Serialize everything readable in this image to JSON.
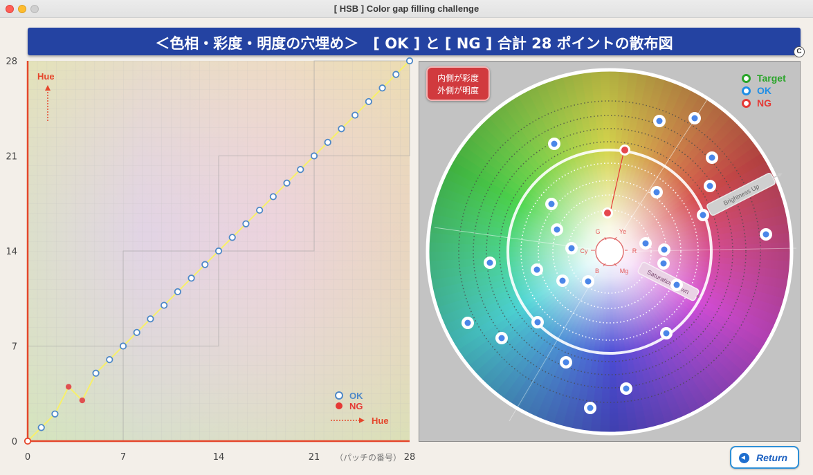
{
  "window": {
    "title": "[ HSB ] Color gap filling challenge"
  },
  "banner": {
    "title": "＜色相・彩度・明度の穴埋め＞　[ OK ] と [ NG ]  合計 28 ポイントの散布図",
    "badge": "C"
  },
  "chart_data": {
    "type": "line",
    "x": [
      0,
      1,
      2,
      3,
      4,
      5,
      6,
      7,
      8,
      9,
      10,
      11,
      12,
      13,
      14,
      15,
      16,
      17,
      18,
      19,
      20,
      21,
      22,
      23,
      24,
      25,
      26,
      27,
      28
    ],
    "series": [
      {
        "name": "OK",
        "status": [
          "ok",
          "ok",
          "ok",
          "ng",
          "ng",
          "ok",
          "ok",
          "ok",
          "ok",
          "ok",
          "ok",
          "ok",
          "ok",
          "ok",
          "ok",
          "ok",
          "ok",
          "ok",
          "ok",
          "ok",
          "ok",
          "ok",
          "ok",
          "ok",
          "ok",
          "ok",
          "ok",
          "ok",
          "ok"
        ],
        "values": [
          0,
          1,
          2,
          4,
          3,
          5,
          6,
          7,
          8,
          9,
          10,
          11,
          12,
          13,
          14,
          15,
          16,
          17,
          18,
          19,
          20,
          21,
          22,
          23,
          24,
          25,
          26,
          27,
          28
        ]
      }
    ],
    "xticks": [
      0,
      7,
      14,
      21,
      28
    ],
    "yticks": [
      0,
      7,
      14,
      21,
      28
    ],
    "xlim": [
      0,
      28
    ],
    "ylim": [
      0,
      28
    ],
    "xlabel": "（パッチの番号）",
    "ylabel": "Hue",
    "grid": true,
    "legend": [
      {
        "label": "OK",
        "color": "#4e88c7"
      },
      {
        "label": "NG",
        "color": "#e53935"
      }
    ],
    "legend_position": "bottom-right",
    "arrow_label": "Hue",
    "colors": {
      "line": "#f7f06a",
      "ok_point": "#4e88c7",
      "ng_point": "#e05050",
      "axis": "#e5462b"
    }
  },
  "wheel": {
    "badge_lines": [
      "内側が彩度",
      "外側が明度"
    ],
    "legend": [
      {
        "label": "Target",
        "color": "#2aa52a"
      },
      {
        "label": "OK",
        "color": "#1e8ee6"
      },
      {
        "label": "NG",
        "color": "#e53935"
      }
    ],
    "color_labels": [
      "G",
      "Ye",
      "Cy",
      "R",
      "B",
      "Mg"
    ],
    "brightness_label": "Brightness Up",
    "saturation_label": "Saturation Down"
  },
  "return_button": {
    "label": "Return"
  }
}
